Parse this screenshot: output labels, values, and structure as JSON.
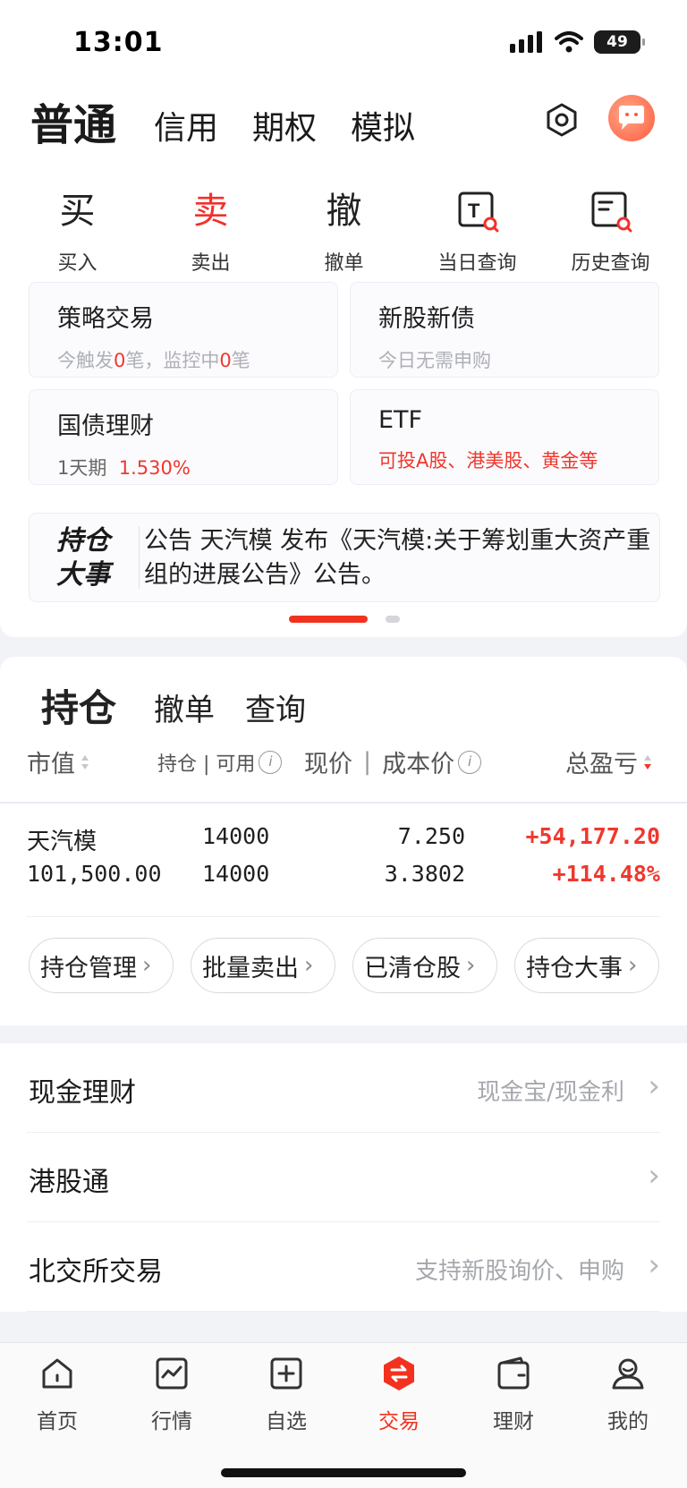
{
  "status_bar": {
    "time": "13:01",
    "battery": "49"
  },
  "account_tabs": [
    "普通",
    "信用",
    "期权",
    "模拟"
  ],
  "quick_actions": [
    {
      "glyph": "买",
      "label": "买入"
    },
    {
      "glyph": "卖",
      "label": "卖出"
    },
    {
      "glyph": "撤",
      "label": "撤单"
    },
    {
      "glyph": "T",
      "label": "当日查询"
    },
    {
      "glyph": "",
      "label": "历史查询"
    }
  ],
  "tiles": {
    "strategy": {
      "title": "策略交易",
      "sub_a": "今触发",
      "sub_a_num": "0",
      "sub_b": "笔，监控中",
      "sub_b_num": "0",
      "sub_c": "笔"
    },
    "ipo": {
      "title": "新股新债",
      "sub": "今日无需申购"
    },
    "bond": {
      "title": "国债理财",
      "term": "1天期",
      "rate": "1.530%"
    },
    "etf": {
      "title": "ETF",
      "sub": "可投A股、港美股、黄金等"
    }
  },
  "notice": {
    "badge": "持仓大事",
    "text": "公告 天汽模 发布《天汽模:关于筹划重大资产重组的进展公告》公告。"
  },
  "position_tabs": [
    "持仓",
    "撤单",
    "查询"
  ],
  "columns": {
    "market_value": "市值",
    "hold_avail": "持仓 | 可用",
    "price_cost_a": "现价",
    "price_cost_b": "成本价",
    "total_pl": "总盈亏"
  },
  "holdings": [
    {
      "name": "天汽模",
      "market_value": "101,500.00",
      "hold": "14000",
      "available": "14000",
      "price": "7.250",
      "cost": "3.3802",
      "pl": "+54,177.20",
      "pl_pct": "+114.48%"
    }
  ],
  "action_pills": [
    "持仓管理",
    "批量卖出",
    "已清仓股",
    "持仓大事"
  ],
  "list_rows": [
    {
      "title": "现金理财",
      "hint": "现金宝/现金利"
    },
    {
      "title": "港股通",
      "hint": ""
    },
    {
      "title": "北交所交易",
      "hint": "支持新股询价、申购"
    }
  ],
  "bottom_nav": [
    "首页",
    "行情",
    "自选",
    "交易",
    "理财",
    "我的"
  ],
  "colors": {
    "accent": "#f2321f",
    "profit": "#f0372d"
  }
}
